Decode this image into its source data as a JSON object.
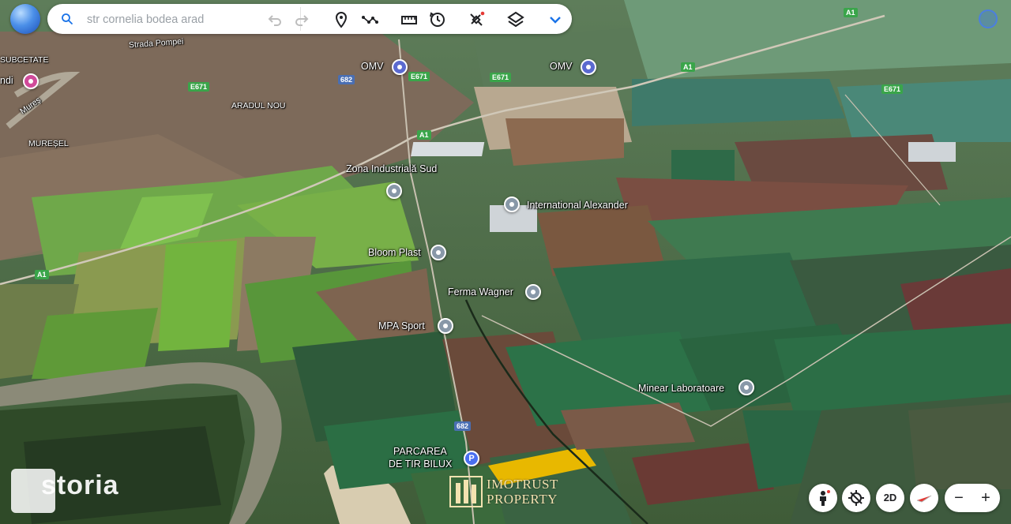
{
  "search": {
    "placeholder": "str cornelia bodea arad"
  },
  "toolbar": {
    "undo": "undo-icon",
    "redo": "redo-icon",
    "pin": "place-pin-icon",
    "path": "path-icon",
    "measure": "ruler-icon",
    "history": "history-icon",
    "tools": "satellite-icon",
    "layers": "layers-icon",
    "more": "chevron-down-icon"
  },
  "places": {
    "subcetate": "SUBCETATE",
    "strada_pompei": "Strada Pompei",
    "landi": "ndi",
    "mures": "Mureș",
    "muresel": "MUREȘEL",
    "aradul_nou": "ARADUL NOU",
    "omv1": "OMV",
    "omv2": "OMV",
    "zona": "Zona Industrială Sud",
    "international": "International Alexander",
    "bloom": "Bloom Plast",
    "ferma": "Ferma Wagner",
    "mpa": "MPA Sport",
    "minear": "Minear Laboratoare",
    "parcarea1": "PARCAREA",
    "parcarea2": "DE TIR BILUX"
  },
  "roads": {
    "a1_top": "A1",
    "a1_mid": "A1",
    "a1_left": "A1",
    "a1_upper": "A1",
    "e671_a": "E671",
    "e671_b": "E671",
    "e671_c": "E671",
    "e671_d": "E671",
    "e671_e": "E671",
    "r682_a": "682",
    "r682_b": "682"
  },
  "controls": {
    "mode_2d": "2D",
    "zoom_out": "−",
    "zoom_in": "+"
  },
  "watermarks": {
    "storia": "storia",
    "imotrust_line1": "IMOTRUST",
    "imotrust_line2": "PROPERTY"
  },
  "colors": {
    "accent": "#1a73e8",
    "highlight_parcel": "#e8b800"
  }
}
